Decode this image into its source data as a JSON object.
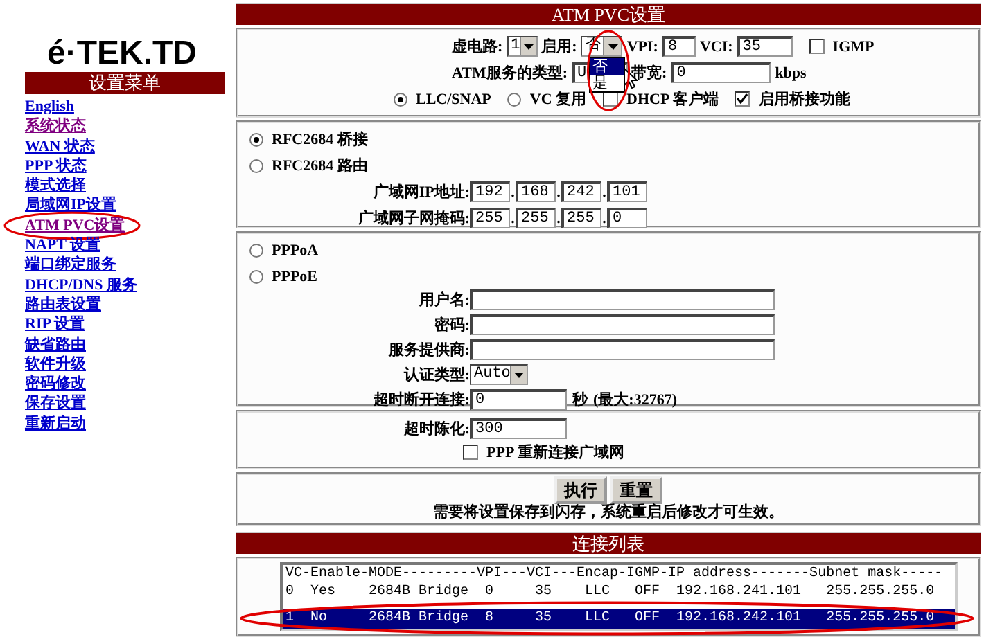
{
  "logo": "é·TEK.TD",
  "sidebar": {
    "title": "设置菜单",
    "items": [
      {
        "label": "English",
        "visited": false,
        "circled": false
      },
      {
        "label": "系统状态",
        "visited": true,
        "circled": false
      },
      {
        "label": "WAN 状态",
        "visited": false,
        "circled": false
      },
      {
        "label": "PPP 状态",
        "visited": false,
        "circled": false
      },
      {
        "label": "模式选择",
        "visited": false,
        "circled": false
      },
      {
        "label": "局域网IP设置",
        "visited": false,
        "circled": false
      },
      {
        "label": "ATM PVC设置",
        "visited": true,
        "circled": true
      },
      {
        "label": "NAPT 设置",
        "visited": false,
        "circled": false
      },
      {
        "label": "端口绑定服务",
        "visited": false,
        "circled": false
      },
      {
        "label": "DHCP/DNS 服务",
        "visited": false,
        "circled": false
      },
      {
        "label": "路由表设置",
        "visited": false,
        "circled": false
      },
      {
        "label": "RIP 设置",
        "visited": false,
        "circled": false
      },
      {
        "label": "缺省路由",
        "visited": false,
        "circled": false
      },
      {
        "label": "软件升级",
        "visited": false,
        "circled": false
      },
      {
        "label": "密码修改",
        "visited": false,
        "circled": false
      },
      {
        "label": "保存设置",
        "visited": false,
        "circled": false
      },
      {
        "label": "重新启动",
        "visited": false,
        "circled": false
      }
    ]
  },
  "panel": {
    "title": "ATM PVC设置",
    "vc": {
      "label": "虚电路:",
      "value": "1"
    },
    "enable": {
      "label": "启用:",
      "value": "否",
      "expanded": true,
      "circled": true,
      "options": [
        {
          "label": "否",
          "selected": true
        },
        {
          "label": "是",
          "selected": false
        }
      ]
    },
    "vpi": {
      "label": "VPI:",
      "value": "8"
    },
    "vci": {
      "label": "VCI:",
      "value": "35"
    },
    "igmp": {
      "label": "IGMP",
      "checked": false
    },
    "service_type": {
      "label": "ATM服务的类型:",
      "value": "U"
    },
    "bandwidth": {
      "label": "带宽:",
      "value": "0",
      "unit": "kbps"
    },
    "encap_options": [
      {
        "label": "LLC/SNAP",
        "selected": true
      },
      {
        "label": "VC 复用",
        "selected": false
      }
    ],
    "dhcp_client": {
      "label": "DHCP 客户端",
      "checked": false
    },
    "bridging": {
      "label": "启用桥接功能",
      "checked": true
    },
    "modes": [
      {
        "label": "RFC2684 桥接",
        "selected": true
      },
      {
        "label": "RFC2684 路由",
        "selected": false
      },
      {
        "label": "PPPoA",
        "selected": false
      },
      {
        "label": "PPPoE",
        "selected": false
      }
    ],
    "wan_ip": {
      "label": "广域网IP地址:",
      "separator": ".",
      "octets": [
        "192",
        "168",
        "242",
        "101"
      ]
    },
    "wan_mask": {
      "label": "广域网子网掩码:",
      "separator": ".",
      "octets": [
        "255",
        "255",
        "255",
        "0"
      ]
    },
    "ppp_fields": [
      {
        "kind": "text",
        "label": "用户名:"
      },
      {
        "kind": "password",
        "label": "密码:"
      },
      {
        "kind": "text",
        "label": "服务提供商:"
      },
      {
        "kind": "select",
        "label": "认证类型:",
        "value": "Auto"
      },
      {
        "kind": "number",
        "label": "超时断开连接:",
        "value": "0",
        "unit": "秒",
        "note": "(最大:32767)"
      }
    ],
    "idle_timeout": {
      "label": "超时陈化:",
      "value": "300"
    },
    "ppp_reconnect": {
      "label": "PPP 重新连接广域网",
      "checked": false
    },
    "buttons": [
      "执行",
      "重置"
    ],
    "note": "需要将设置保存到闪存，系统重启后修改才可生效。"
  },
  "connection_list": {
    "title": "连接列表",
    "header": "VC-Enable-MODE---------VPI---VCI---Encap-IGMP-IP address-------Subnet mask-----",
    "circled": true,
    "rows": [
      {
        "text": "0  Yes    2684B Bridge  0     35    LLC   OFF  192.168.241.101   255.255.255.0",
        "selected": false
      },
      {
        "text": "1  No     2684B Bridge  8     35    LLC   OFF  192.168.242.101   255.255.255.0",
        "selected": true
      }
    ]
  }
}
